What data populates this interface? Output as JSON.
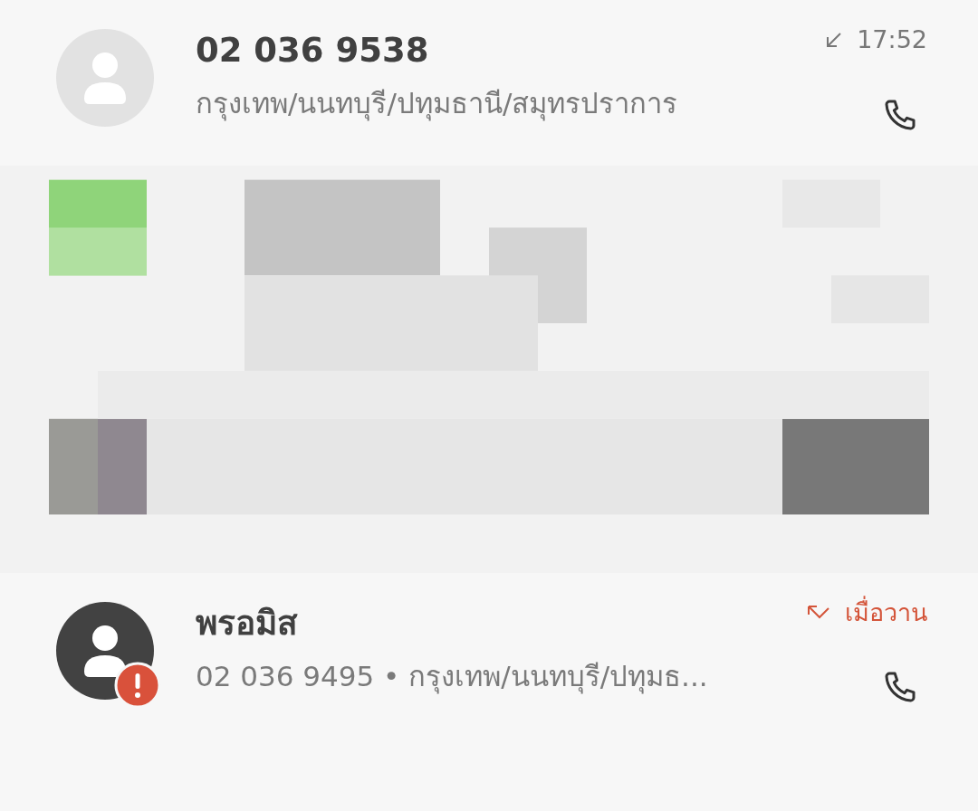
{
  "calls": [
    {
      "kind": "incoming",
      "title": "02 036 9538",
      "subtitle": "กรุงเทพ/นนทบุรี/ปทุมธานี/สมุทรปราการ",
      "time": "17:52",
      "warning": false
    },
    {
      "kind": "picture"
    },
    {
      "kind": "missed",
      "title": "พรอมิส",
      "subtitle": "02 036 9495 • กรุงเทพ/นนทบุรี/ปทุมธ...",
      "time": "เมื่อวาน",
      "warning": true
    }
  ]
}
